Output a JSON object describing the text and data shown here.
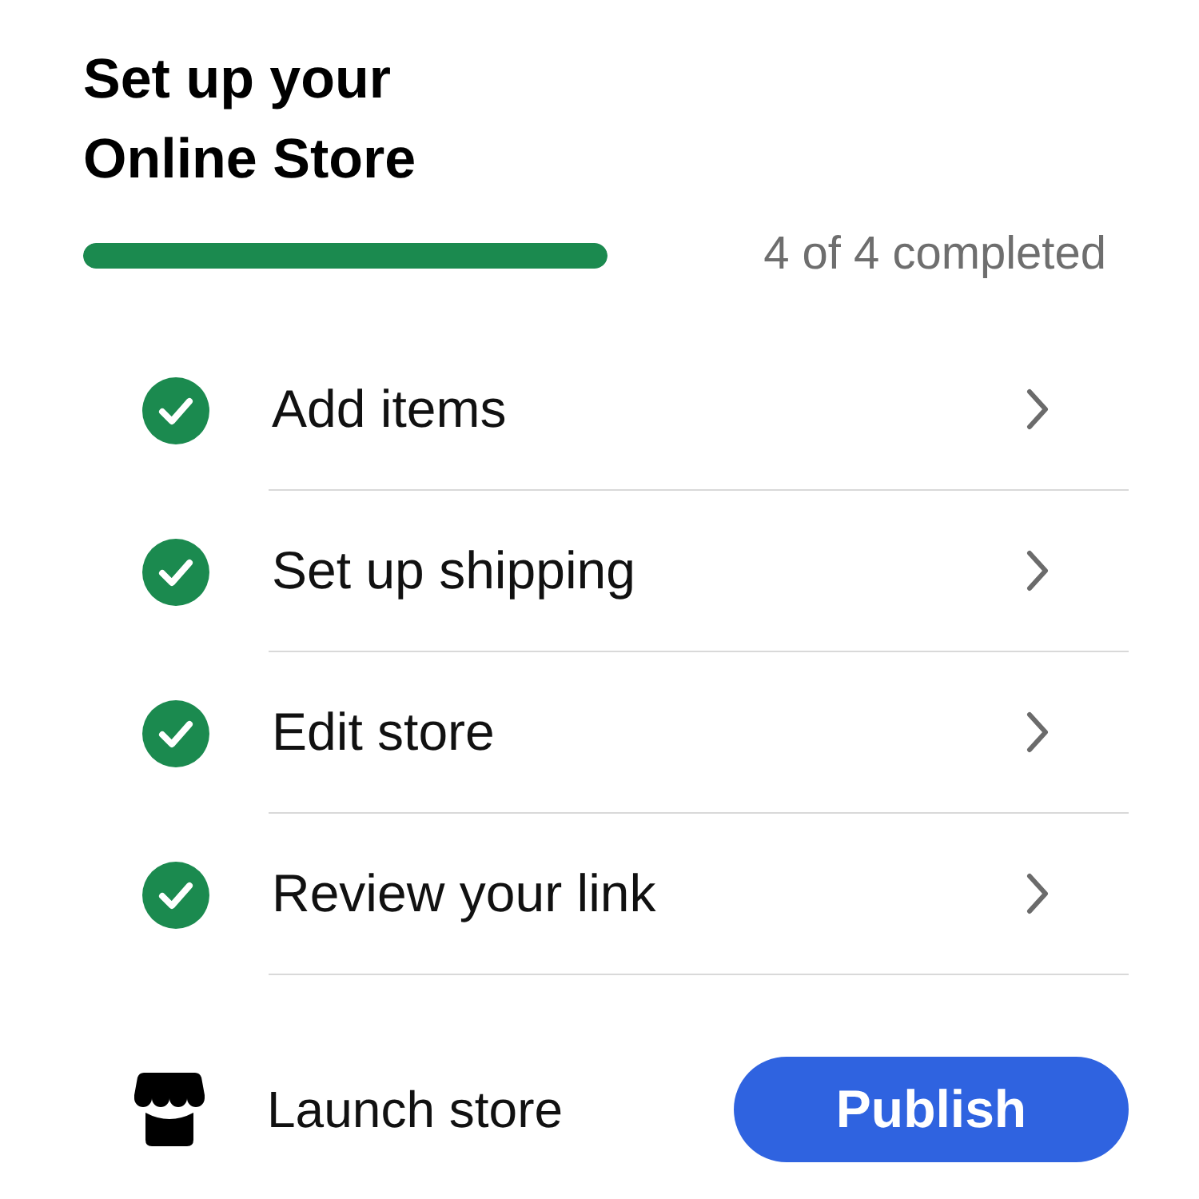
{
  "title": "Set up your Online Store",
  "progress": {
    "level": 1,
    "label": "4 of 4 completed"
  },
  "tasks": [
    {
      "label": "Add items",
      "checked": true
    },
    {
      "label": "Set up shipping",
      "checked": true
    },
    {
      "label": "Edit store",
      "checked": true
    },
    {
      "label": "Review your link",
      "checked": true
    }
  ],
  "launch": {
    "label": "Launch store",
    "button": "Publish"
  }
}
